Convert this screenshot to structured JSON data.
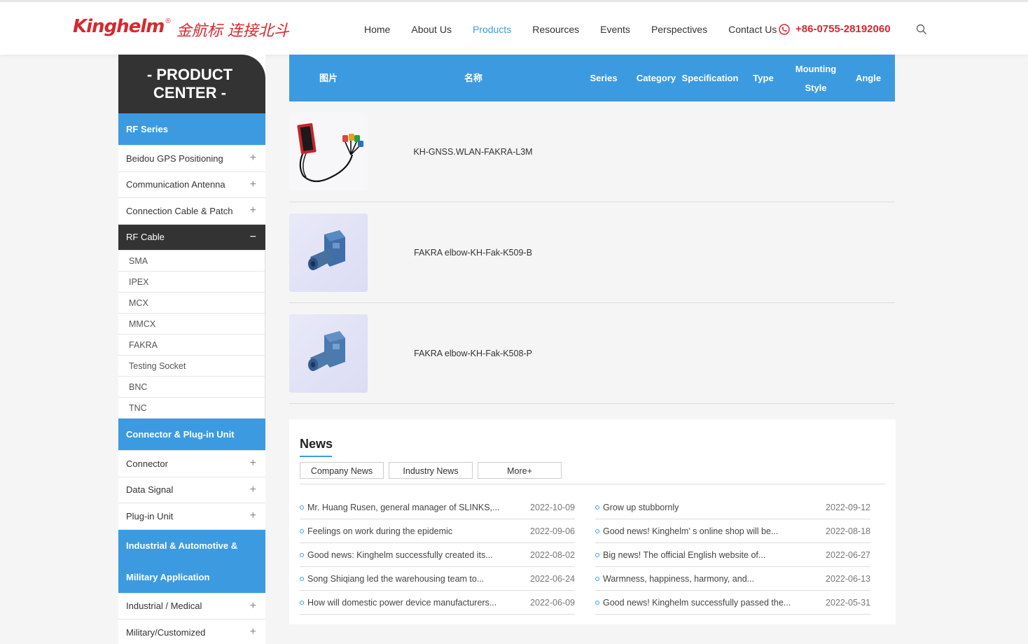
{
  "header": {
    "logo_en": "Kinghelm",
    "logo_reg": "®",
    "logo_cn": "金航标 连接北斗",
    "nav": [
      {
        "label": "Home",
        "active": false
      },
      {
        "label": "About Us",
        "active": false
      },
      {
        "label": "Products",
        "active": true
      },
      {
        "label": "Resources",
        "active": false
      },
      {
        "label": "Events",
        "active": false
      },
      {
        "label": "Perspectives",
        "active": false
      },
      {
        "label": "Contact Us",
        "active": false
      }
    ],
    "phone": "+86-0755-28192060"
  },
  "sidebar": {
    "title_line1": "- PRODUCT",
    "title_line2": "CENTER -",
    "cat_rf": "RF Series",
    "rf_items": [
      {
        "label": "Beidou GPS Positioning",
        "toggle": "+"
      },
      {
        "label": "Communication Antenna",
        "toggle": "+"
      },
      {
        "label": "Connection Cable & Patch",
        "toggle": "+"
      }
    ],
    "rf_cable": {
      "label": "RF Cable",
      "toggle": "−"
    },
    "rf_cable_subs": [
      "SMA",
      "IPEX",
      "MCX",
      "MMCX",
      "FAKRA",
      "Testing Socket",
      "BNC",
      "TNC"
    ],
    "cat_connector": "Connector & Plug-in Unit",
    "connector_items": [
      {
        "label": "Connector",
        "toggle": "+"
      },
      {
        "label": "Data Signal",
        "toggle": "+"
      },
      {
        "label": "Plug-in Unit",
        "toggle": "+"
      }
    ],
    "cat_industrial_line1": "Industrial & Automotive &",
    "cat_industrial_line2": "Military Application",
    "industrial_items": [
      {
        "label": "Industrial / Medical",
        "toggle": "+"
      },
      {
        "label": "Military/Customized",
        "toggle": "+"
      }
    ]
  },
  "table": {
    "headers": {
      "image": "图片",
      "name": "名称",
      "series": "Series",
      "category": "Category",
      "specification": "Specification",
      "type": "Type",
      "mounting1": "Mounting",
      "mounting2": "Style",
      "angle": "Angle"
    },
    "rows": [
      {
        "name": "KH-GNSS.WLAN-FAKRA-L3M"
      },
      {
        "name": "FAKRA elbow-KH-Fak-K509-B"
      },
      {
        "name": "FAKRA elbow-KH-Fak-K508-P"
      }
    ]
  },
  "news": {
    "title": "News",
    "tabs": [
      "Company News",
      "Industry News",
      "More+"
    ],
    "left": [
      {
        "title": "Mr. Huang Rusen, general manager of SLINKS,...",
        "date": "2022-10-09"
      },
      {
        "title": "Feelings on work during the epidemic",
        "date": "2022-09-06"
      },
      {
        "title": "Good news: Kinghelm successfully created its...",
        "date": "2022-08-02"
      },
      {
        "title": "Song Shiqiang led the warehousing team to...",
        "date": "2022-06-24"
      },
      {
        "title": "How will domestic power device manufacturers...",
        "date": "2022-06-09"
      }
    ],
    "right": [
      {
        "title": "Grow up stubbornly",
        "date": "2022-09-12"
      },
      {
        "title": "Good news! Kinghelm’ s online shop will be...",
        "date": "2022-08-18"
      },
      {
        "title": "Big news! The official English website of...",
        "date": "2022-06-27"
      },
      {
        "title": "Warmness, happiness, harmony, and...",
        "date": "2022-06-13"
      },
      {
        "title": "Good news! Kinghelm successfully passed the...",
        "date": "2022-05-31"
      }
    ]
  },
  "colors": {
    "brand_red": "#d7282f",
    "accent_blue": "#3c9be0",
    "dark": "#333333"
  }
}
